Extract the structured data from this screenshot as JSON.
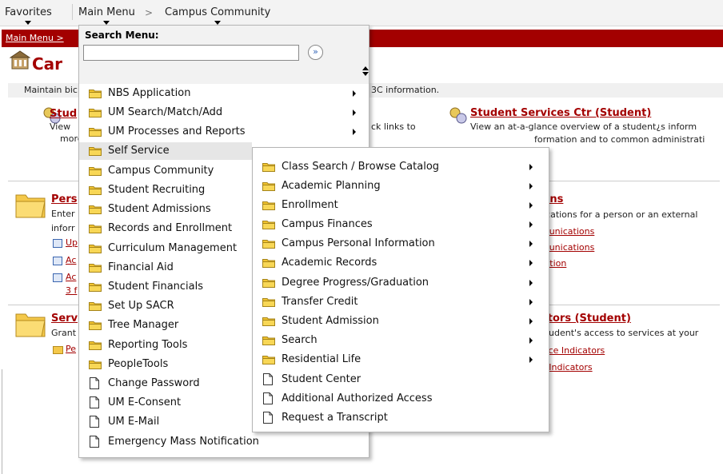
{
  "topnav": {
    "favorites": "Favorites",
    "main_menu": "Main Menu",
    "separator": ">",
    "campus_community": "Campus Community"
  },
  "breadcrumb": "Main Menu >",
  "page_title": "Car",
  "description_left": "Maintain bic",
  "description_right": "3C information.",
  "bg": {
    "stud_link": "Stud",
    "view": "View",
    "more": "more",
    "quick_links": "ck links to",
    "ssc_title": "Student Services Ctr (Student)",
    "ssc_desc1": "View an at-a-glance overview of a student¿s inform",
    "ssc_desc2": "formation and to common administrati",
    "pers_link": "Pers",
    "enter": "Enter",
    "inform": "inforr",
    "up": "Up",
    "ac1": "Ac",
    "ac2": "Ac",
    "count": "3 f",
    "ions": "ions",
    "nications": "nications for a person or an external",
    "munications1": "munications",
    "munications2": "munications",
    "ration": "ration",
    "serv_link": "Serv",
    "grant": "Grant",
    "pe": "Pe",
    "ators": "ators (Student)",
    "students_access": "student's access to services at your",
    "vice_indicators": "vice Indicators",
    "e_indicators": "e Indicators"
  },
  "search": {
    "label": "Search Menu:",
    "value": "",
    "go": "»"
  },
  "main_menu_items": [
    {
      "label": "NBS Application",
      "type": "folder",
      "arrow": true
    },
    {
      "label": "UM Search/Match/Add",
      "type": "folder",
      "arrow": true
    },
    {
      "label": "UM Processes and Reports",
      "type": "folder",
      "arrow": true
    },
    {
      "label": "Self Service",
      "type": "folder",
      "arrow": false,
      "highlighted": true
    },
    {
      "label": "Campus Community",
      "type": "folder",
      "arrow": false
    },
    {
      "label": "Student Recruiting",
      "type": "folder",
      "arrow": false
    },
    {
      "label": "Student Admissions",
      "type": "folder",
      "arrow": false
    },
    {
      "label": "Records and Enrollment",
      "type": "folder",
      "arrow": false
    },
    {
      "label": "Curriculum Management",
      "type": "folder",
      "arrow": false
    },
    {
      "label": "Financial Aid",
      "type": "folder",
      "arrow": false
    },
    {
      "label": "Student Financials",
      "type": "folder",
      "arrow": false
    },
    {
      "label": "Set Up SACR",
      "type": "folder",
      "arrow": false
    },
    {
      "label": "Tree Manager",
      "type": "folder",
      "arrow": false
    },
    {
      "label": "Reporting Tools",
      "type": "folder",
      "arrow": false
    },
    {
      "label": "PeopleTools",
      "type": "folder",
      "arrow": false
    },
    {
      "label": "Change Password",
      "type": "doc",
      "arrow": false
    },
    {
      "label": "UM E-Consent",
      "type": "doc",
      "arrow": false
    },
    {
      "label": "UM E-Mail",
      "type": "doc",
      "arrow": false
    },
    {
      "label": "Emergency Mass Notification",
      "type": "doc",
      "arrow": false
    }
  ],
  "self_service_items": [
    {
      "label": "Class Search / Browse Catalog",
      "type": "folder",
      "arrow": true
    },
    {
      "label": "Academic Planning",
      "type": "folder",
      "arrow": true
    },
    {
      "label": "Enrollment",
      "type": "folder",
      "arrow": true
    },
    {
      "label": "Campus Finances",
      "type": "folder",
      "arrow": true
    },
    {
      "label": "Campus Personal Information",
      "type": "folder",
      "arrow": true
    },
    {
      "label": "Academic Records",
      "type": "folder",
      "arrow": true
    },
    {
      "label": "Degree Progress/Graduation",
      "type": "folder",
      "arrow": true
    },
    {
      "label": "Transfer Credit",
      "type": "folder",
      "arrow": true
    },
    {
      "label": "Student Admission",
      "type": "folder",
      "arrow": true
    },
    {
      "label": "Search",
      "type": "folder",
      "arrow": true
    },
    {
      "label": "Residential Life",
      "type": "folder",
      "arrow": true
    },
    {
      "label": "Student Center",
      "type": "doc",
      "arrow": false
    },
    {
      "label": "Additional Authorized Access",
      "type": "doc",
      "arrow": false,
      "highlighted": true
    },
    {
      "label": "Request a Transcript",
      "type": "doc",
      "arrow": false
    }
  ],
  "colors": {
    "brand_red": "#a30000",
    "highlight_yellow": "#fbfb3c",
    "folder": "#f2c430"
  }
}
